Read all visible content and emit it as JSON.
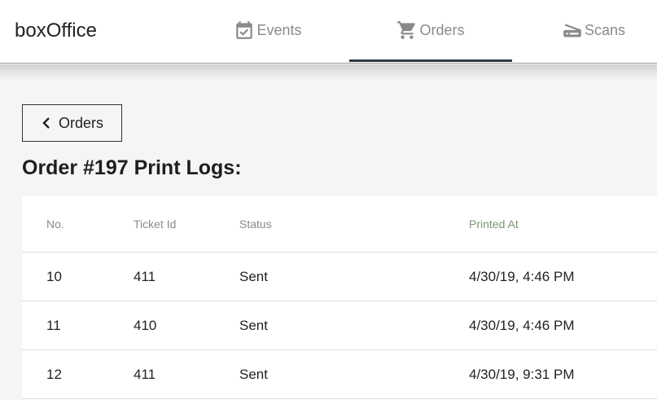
{
  "app": {
    "title": "boxOffice"
  },
  "nav": {
    "tabs": [
      {
        "label": "Events",
        "icon": "calendar-check-icon"
      },
      {
        "label": "Orders",
        "icon": "cart-icon"
      },
      {
        "label": "Scans",
        "icon": "scanner-icon"
      }
    ],
    "active": "Orders"
  },
  "back_button": {
    "label": "Orders",
    "icon": "chevron-left-icon"
  },
  "page": {
    "title": "Order #197 Print Logs:"
  },
  "table": {
    "columns": [
      "No.",
      "Ticket Id",
      "Status",
      "Printed At"
    ],
    "rows": [
      {
        "no": "10",
        "ticket_id": "411",
        "status": "Sent",
        "printed_at": "4/30/19, 4:46 PM"
      },
      {
        "no": "11",
        "ticket_id": "410",
        "status": "Sent",
        "printed_at": "4/30/19, 4:46 PM"
      },
      {
        "no": "12",
        "ticket_id": "411",
        "status": "Sent",
        "printed_at": "4/30/19, 9:31 PM"
      }
    ]
  },
  "colors": {
    "active_underline": "#2e3a44",
    "header_accent": "#7d9477"
  }
}
